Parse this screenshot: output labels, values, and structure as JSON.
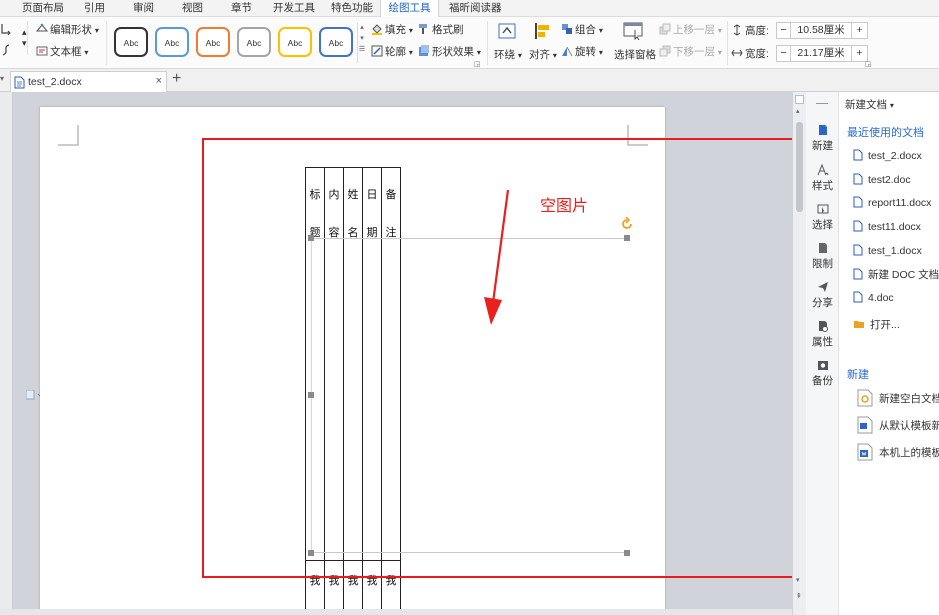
{
  "menu_tabs": [
    "页面布局",
    "引用",
    "审阅",
    "视图",
    "章节",
    "开发工具",
    "特色功能",
    "绘图工具",
    "福昕阅读器"
  ],
  "active_tab": "绘图工具",
  "ribbon": {
    "edit_shape": "编辑形状",
    "textbox": "文本框",
    "style_samples": [
      {
        "label": "Abc",
        "border": "#333333"
      },
      {
        "label": "Abc",
        "border": "#5b9bd5"
      },
      {
        "label": "Abc",
        "border": "#ed7d31"
      },
      {
        "label": "Abc",
        "border": "#a5a5a5"
      },
      {
        "label": "Abc",
        "border": "#ffc000"
      },
      {
        "label": "Abc",
        "border": "#4472c4"
      }
    ],
    "fill": "填充",
    "format_painter": "格式刷",
    "outline": "轮廓",
    "shape_effects": "形状效果",
    "wrap": "环绕",
    "align": "对齐",
    "group": "组合",
    "rotate": "旋转",
    "selection_pane": "选择窗格",
    "bring_forward": "上移一层",
    "send_backward": "下移一层",
    "height_label": "高度:",
    "height_value": "10.58厘米",
    "width_label": "宽度:",
    "width_value": "21.17厘米",
    "minus": "−",
    "plus": "+"
  },
  "doc_tab": {
    "filename": "test_2.docx",
    "close": "×",
    "add": "+"
  },
  "document": {
    "header_cells": [
      [
        "标",
        "题"
      ],
      [
        "内",
        "容"
      ],
      [
        "姓",
        "名"
      ],
      [
        "日",
        "期"
      ],
      [
        "备",
        "注"
      ]
    ],
    "body_cells": [
      "我",
      "我",
      "我",
      "我",
      "我"
    ]
  },
  "annotation": "空图片",
  "rail": [
    "新建",
    "样式",
    "选择",
    "限制",
    "分享",
    "属性",
    "备份"
  ],
  "panel": {
    "new_doc": "新建文档",
    "recent_heading": "最近使用的文档",
    "recent": [
      "test_2.docx",
      "test2.doc",
      "report11.docx",
      "test11.docx",
      "test_1.docx",
      "新建 DOC 文档.",
      "4.doc"
    ],
    "open": "打开...",
    "new_heading": "新建",
    "new_items": [
      "新建空白文档",
      "从默认模板新",
      "本机上的模板"
    ]
  },
  "colors": {
    "accent": "#1e63b9",
    "annotation": "#e8211d"
  }
}
